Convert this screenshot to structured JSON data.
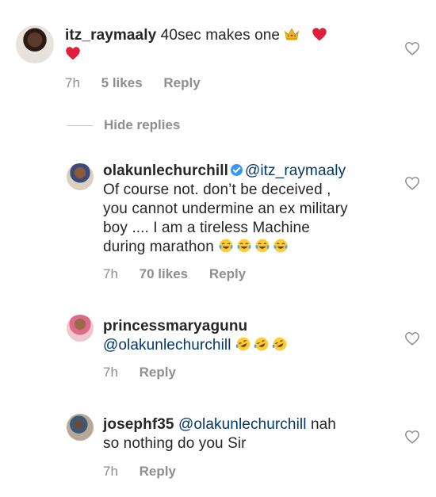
{
  "main_comment": {
    "username": "itz_raymaaly",
    "text": "40sec makes one",
    "time": "7h",
    "likes": "5 likes",
    "reply_label": "Reply"
  },
  "hide_replies_label": "Hide replies",
  "replies": [
    {
      "username": "olakunlechurchill",
      "mention": "@itz_raymaaly",
      "lines": [
        "Of course not.  don’t be deceived ,",
        "you cannot undermine an ex military",
        "boy .... I am a tireless Machine",
        "during marathon"
      ],
      "time": "7h",
      "likes": "70 likes",
      "reply_label": "Reply"
    },
    {
      "username": "princessmaryagunu",
      "mention": "@olakunlechurchill",
      "time": "7h",
      "reply_label": "Reply"
    },
    {
      "username": "josephf35",
      "mention": "@olakunlechurchill",
      "text_after": "nah",
      "line2": "so nothing do you Sir",
      "time": "7h",
      "reply_label": "Reply"
    }
  ],
  "icons": {
    "heart_outline": "heart-icon",
    "verified": "verified-badge-icon",
    "crown": "crown-emoji",
    "red_heart": "red-heart-emoji",
    "tears_of_joy": "face-with-tears-of-joy-emoji",
    "rofl": "rolling-on-floor-laughing-emoji"
  },
  "colors": {
    "text": "#262626",
    "secondary": "#8e8e8e",
    "mention": "#00376b",
    "verified": "#3897f0"
  }
}
